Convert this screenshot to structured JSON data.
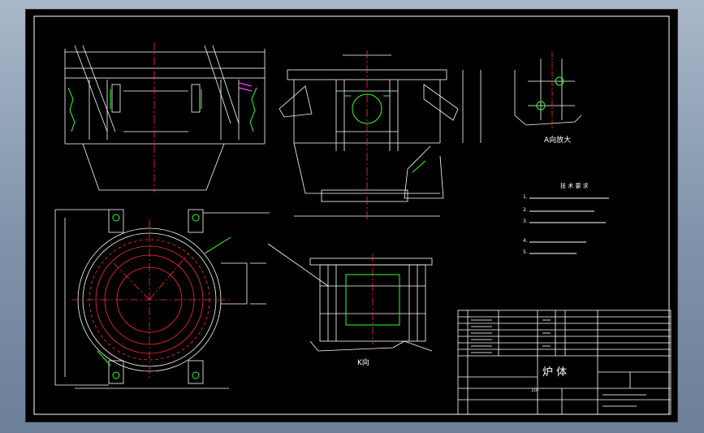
{
  "views": {
    "a_label": "A向放大",
    "k_label": "K向"
  },
  "tech_requirements": {
    "title": "技 术 要 求",
    "items": [
      "1.",
      "2.",
      "3.",
      "4.",
      "5."
    ]
  },
  "title_block": {
    "drawing_name": "炉 体",
    "prefix": "10-"
  },
  "colors": {
    "line": "#ffffff",
    "center": "#ff3030",
    "green": "#30ff30",
    "magenta": "#ff40ff",
    "background": "#000000"
  }
}
